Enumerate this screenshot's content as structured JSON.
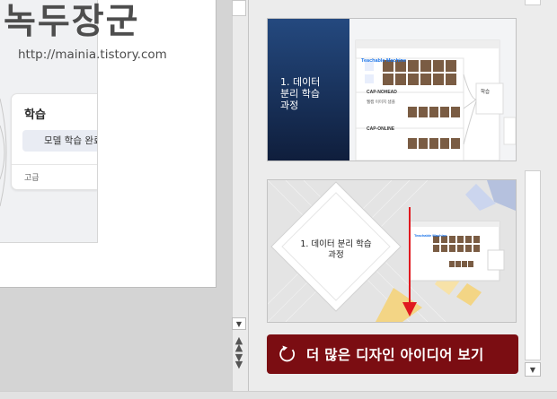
{
  "watermark": {
    "title": "녹두장군",
    "url": "http://mainia.tistory.com"
  },
  "slide_card": {
    "title": "학습",
    "button_label": "모델 학습 완료",
    "advanced_label": "고급"
  },
  "designs": [
    {
      "title": "1. 데이터\n분리 학습\n과정",
      "app_name": "Teachable Machine",
      "class1": "CAP-NOHEAD",
      "class2": "CAP-ONLINE",
      "train_label": "학습",
      "sample_label": "웹캠 이미지 샘플"
    },
    {
      "title": "1. 데이터 분리 학습\n과정",
      "app_name": "Teachable Machine"
    }
  ],
  "more_ideas": {
    "label": "더 많은 디자인 아이디어 보기",
    "icon": "refresh-icon"
  },
  "colors": {
    "accent": "#7b0d12",
    "slide_blue": "#1d3f78",
    "arrow_red": "#e0191f",
    "diamond_yellow": "#f5d98a"
  }
}
